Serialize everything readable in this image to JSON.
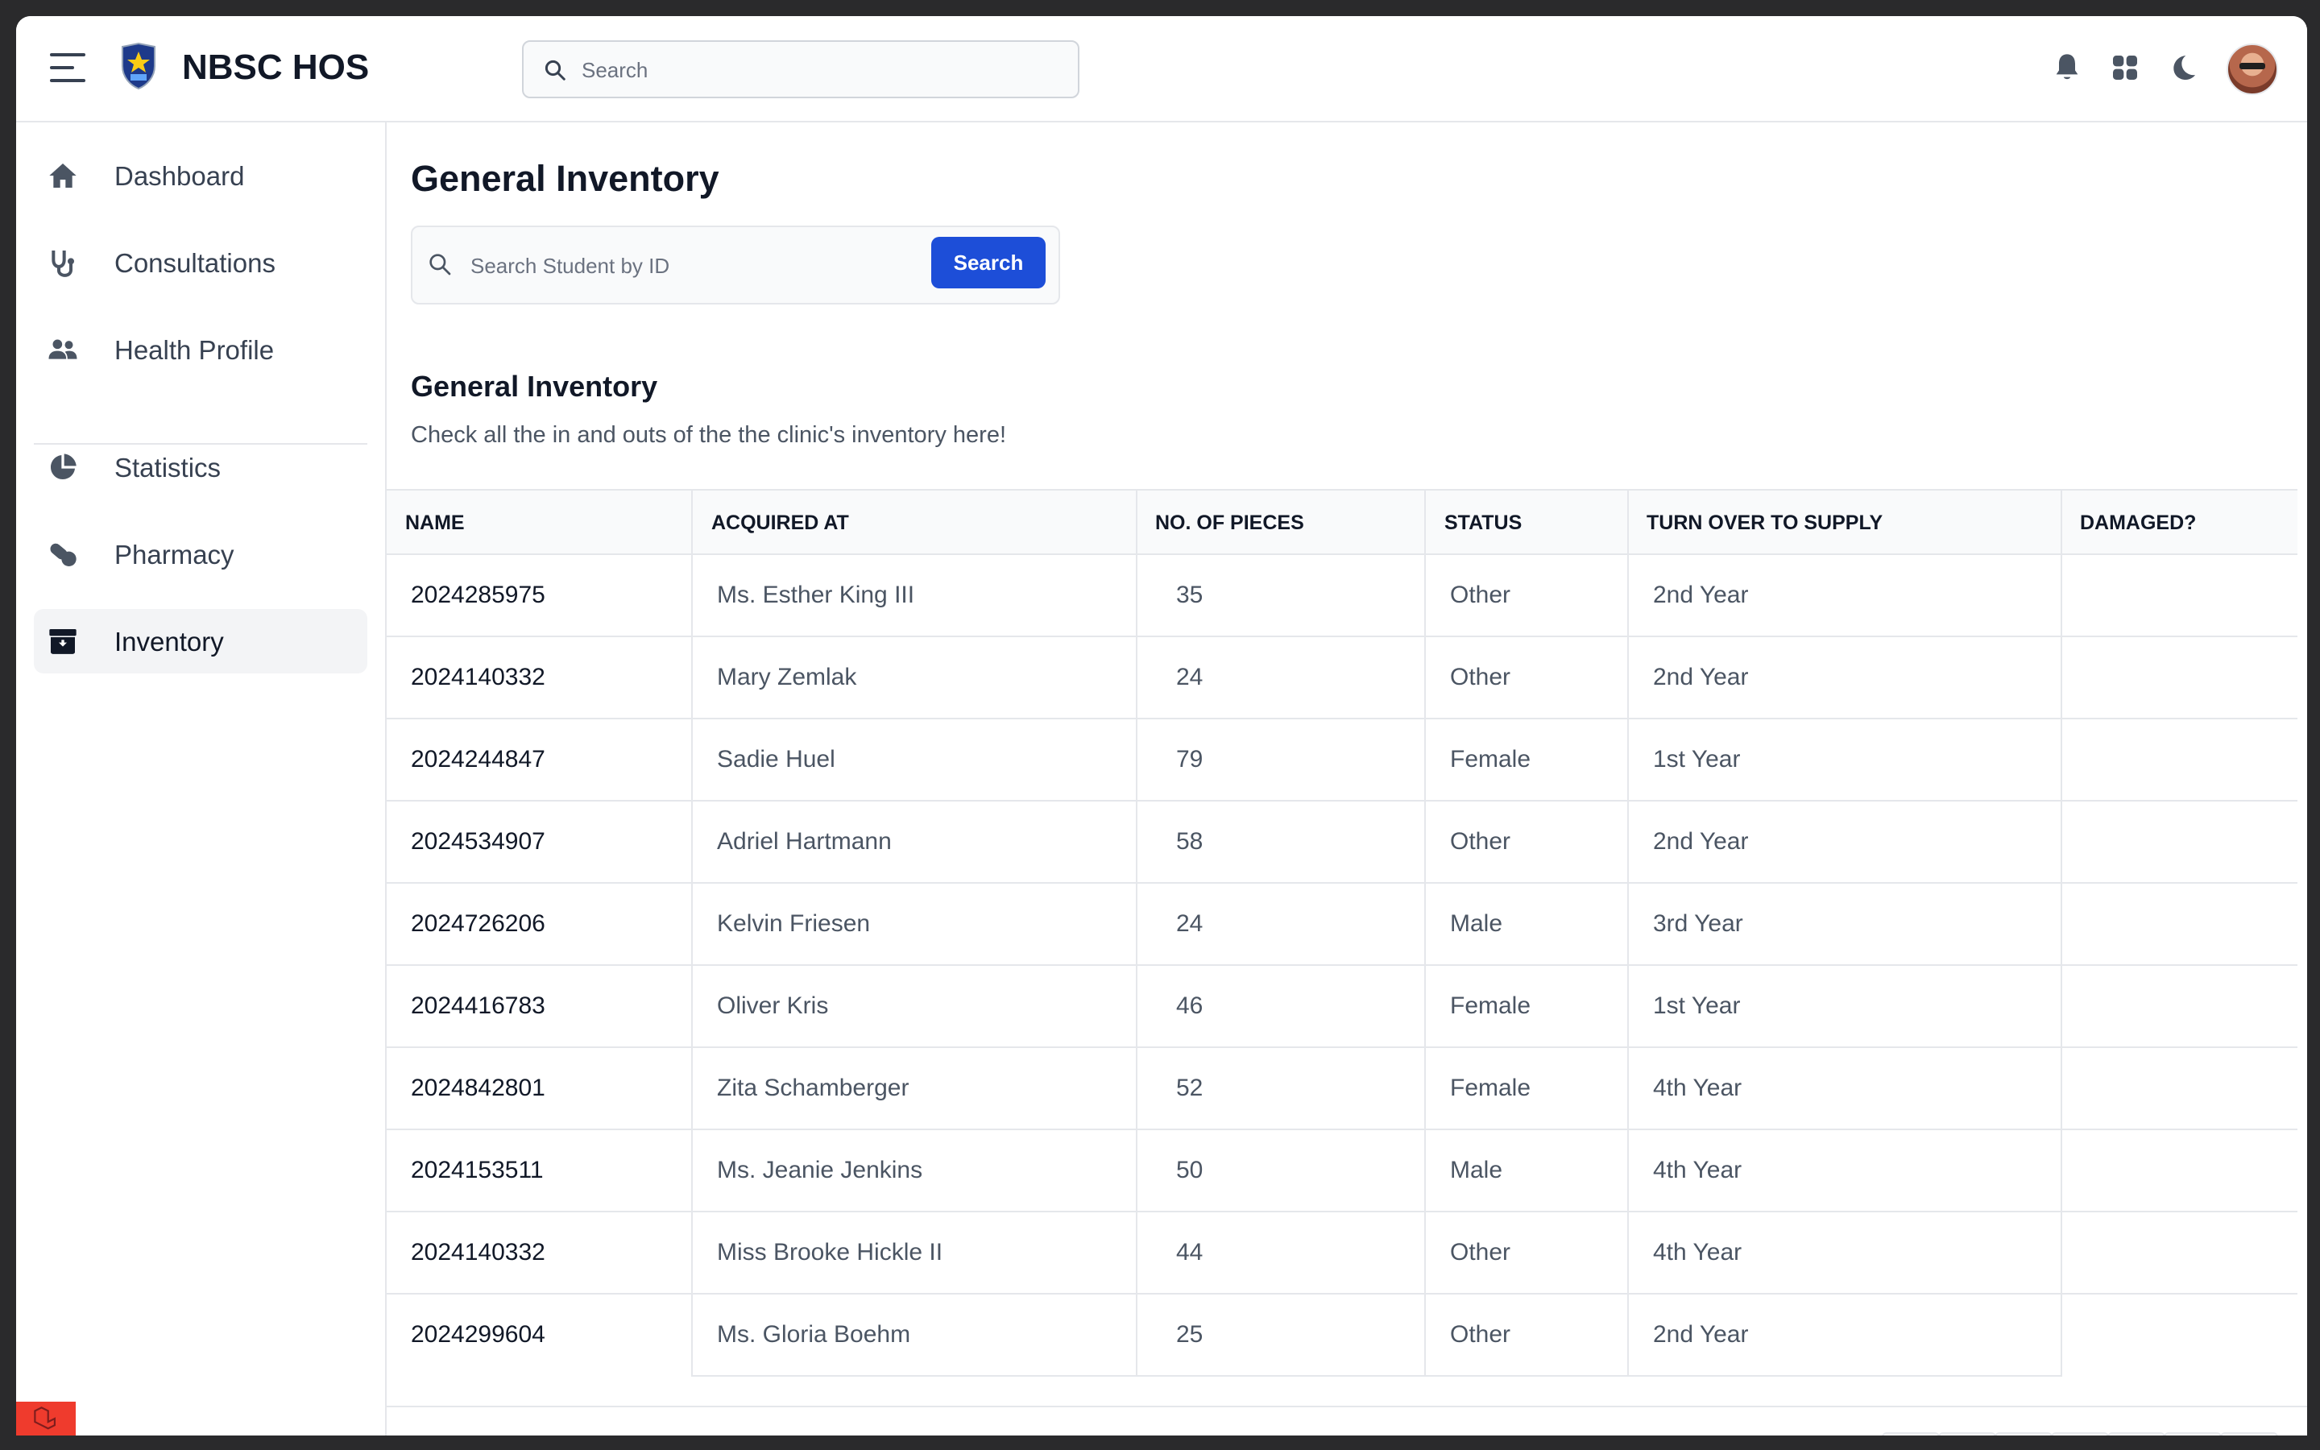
{
  "app": {
    "brand": "NBSC HOS"
  },
  "header": {
    "search_placeholder": "Search",
    "icons": [
      "hamburger-menu-icon",
      "logo",
      "search-icon",
      "bell-icon",
      "apps-grid-icon",
      "moon-icon",
      "avatar"
    ]
  },
  "sidebar": {
    "items": [
      {
        "label": "Dashboard",
        "icon": "home-icon"
      },
      {
        "label": "Consultations",
        "icon": "stethoscope-icon"
      },
      {
        "label": "Health Profile",
        "icon": "users-icon"
      },
      {
        "label": "Statistics",
        "icon": "pie-chart-icon"
      },
      {
        "label": "Pharmacy",
        "icon": "pills-icon"
      },
      {
        "label": "Inventory",
        "icon": "archive-icon",
        "active": true
      }
    ]
  },
  "main": {
    "title": "General Inventory",
    "search": {
      "placeholder": "Search Student by ID",
      "button": "Search"
    },
    "section_title": "General Inventory",
    "section_subtitle": "Check all the in and outs of the the clinic's inventory here!",
    "table": {
      "headers": [
        "NAME",
        "ACQUIRED AT",
        "NO. OF PIECES",
        "STATUS",
        "TURN OVER TO SUPPLY",
        "DAMAGED?"
      ],
      "rows": [
        [
          "2024285975",
          "Ms. Esther King III",
          "35",
          "Other",
          "2nd Year",
          ""
        ],
        [
          "2024140332",
          "Mary Zemlak",
          "24",
          "Other",
          "2nd Year",
          ""
        ],
        [
          "2024244847",
          "Sadie Huel",
          "79",
          "Female",
          "1st Year",
          ""
        ],
        [
          "2024534907",
          "Adriel Hartmann",
          "58",
          "Other",
          "2nd Year",
          ""
        ],
        [
          "2024726206",
          "Kelvin Friesen",
          "24",
          "Male",
          "3rd Year",
          ""
        ],
        [
          "2024416783",
          "Oliver Kris",
          "46",
          "Female",
          "1st Year",
          ""
        ],
        [
          "2024842801",
          "Zita Schamberger",
          "52",
          "Female",
          "4th Year",
          ""
        ],
        [
          "2024153511",
          "Ms. Jeanie Jenkins",
          "50",
          "Male",
          "4th Year",
          ""
        ],
        [
          "2024140332",
          "Miss Brooke Hickle II",
          "44",
          "Other",
          "4th Year",
          ""
        ],
        [
          "2024299604",
          "Ms. Gloria Boehm",
          "25",
          "Other",
          "2nd Year",
          ""
        ]
      ]
    }
  },
  "colors": {
    "primary": "#1d4ed8",
    "text": "#111827",
    "muted": "#4b5563",
    "border": "#e5e7eb",
    "laravel": "#ef3b2d"
  }
}
